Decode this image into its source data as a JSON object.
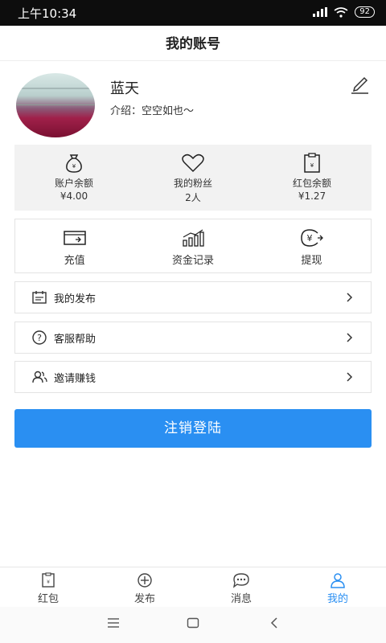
{
  "status": {
    "time": "上午10:34",
    "battery": "92"
  },
  "header": {
    "title": "我的账号"
  },
  "profile": {
    "name": "蓝天",
    "intro": "介绍：空空如也～"
  },
  "stats": [
    {
      "label": "账户余额",
      "value": "¥4.00",
      "icon": "money-bag-icon"
    },
    {
      "label": "我的粉丝",
      "value": "2人",
      "icon": "heart-icon"
    },
    {
      "label": "红包余额",
      "value": "¥1.27",
      "icon": "red-packet-icon"
    }
  ],
  "actions": [
    {
      "label": "充值",
      "icon": "recharge-card-icon"
    },
    {
      "label": "资金记录",
      "icon": "bar-chart-icon"
    },
    {
      "label": "提现",
      "icon": "withdraw-icon"
    }
  ],
  "menu": [
    {
      "label": "我的发布",
      "icon": "calendar-list-icon"
    },
    {
      "label": "客服帮助",
      "icon": "question-icon"
    },
    {
      "label": "邀请赚钱",
      "icon": "users-icon"
    }
  ],
  "logout_label": "注销登陆",
  "tabs": [
    {
      "label": "红包",
      "icon": "red-packet-icon",
      "active": false
    },
    {
      "label": "发布",
      "icon": "plus-circle-icon",
      "active": false
    },
    {
      "label": "消息",
      "icon": "chat-icon",
      "active": false
    },
    {
      "label": "我的",
      "icon": "person-icon",
      "active": true
    }
  ],
  "colors": {
    "accent": "#2a8ff2",
    "statusbar": "#0d0d0d",
    "stats_bg": "#f2f2f2"
  }
}
